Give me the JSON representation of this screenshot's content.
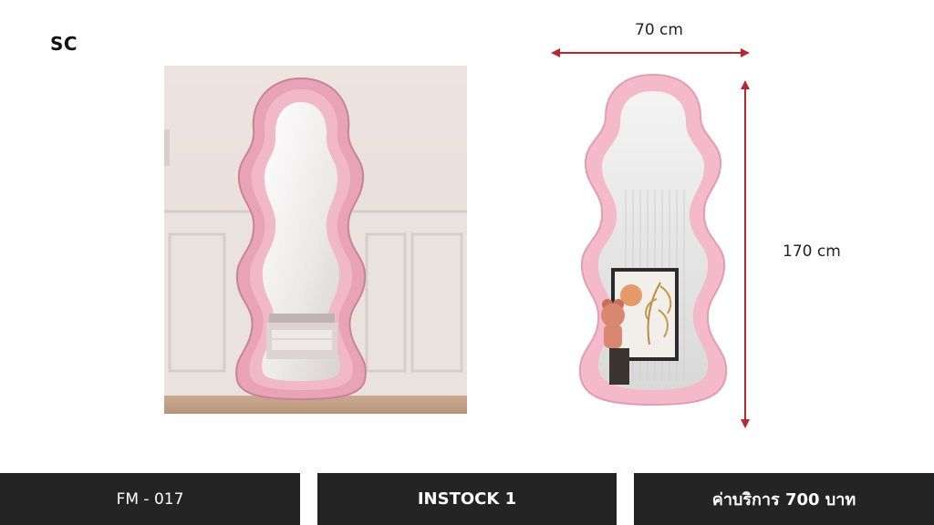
{
  "brand": {
    "label": "SC"
  },
  "dimensions": {
    "width_label": "70 cm",
    "height_label": "170 cm"
  },
  "footer": {
    "code": "FM - 017",
    "stock": "INSTOCK 1",
    "price": "ค่าบริการ 700 บาท"
  },
  "colors": {
    "frame_pink": "#f1b6c7",
    "frame_pink_dark": "#d994a8",
    "dimension_arrow": "#b8282e",
    "footer_bg": "#242424"
  }
}
